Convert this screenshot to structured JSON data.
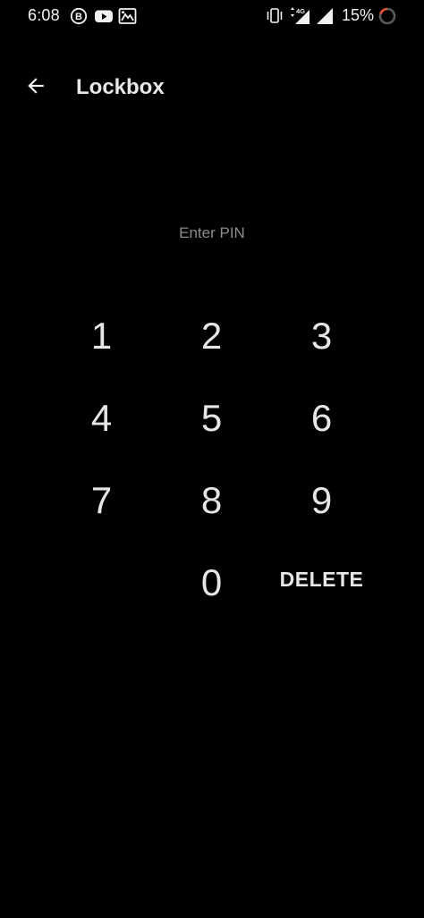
{
  "status_bar": {
    "time": "6:08",
    "notification_icons": [
      "b-circle-icon",
      "youtube-icon",
      "gallery-icon"
    ],
    "system_icons": [
      "vibrate-icon",
      "signal-4g-icon",
      "signal-icon"
    ],
    "battery_percent": "15%"
  },
  "app_bar": {
    "title": "Lockbox",
    "back_icon": "arrow-back-icon"
  },
  "prompt": "Enter PIN",
  "keypad": {
    "k1": "1",
    "k2": "2",
    "k3": "3",
    "k4": "4",
    "k5": "5",
    "k6": "6",
    "k7": "7",
    "k8": "8",
    "k9": "9",
    "k0": "0",
    "delete": "DELETE"
  },
  "colors": {
    "background": "#000000",
    "text": "#e6e6e6",
    "prompt_text": "#8c8c8c",
    "battery_ring": "#e2523b"
  }
}
